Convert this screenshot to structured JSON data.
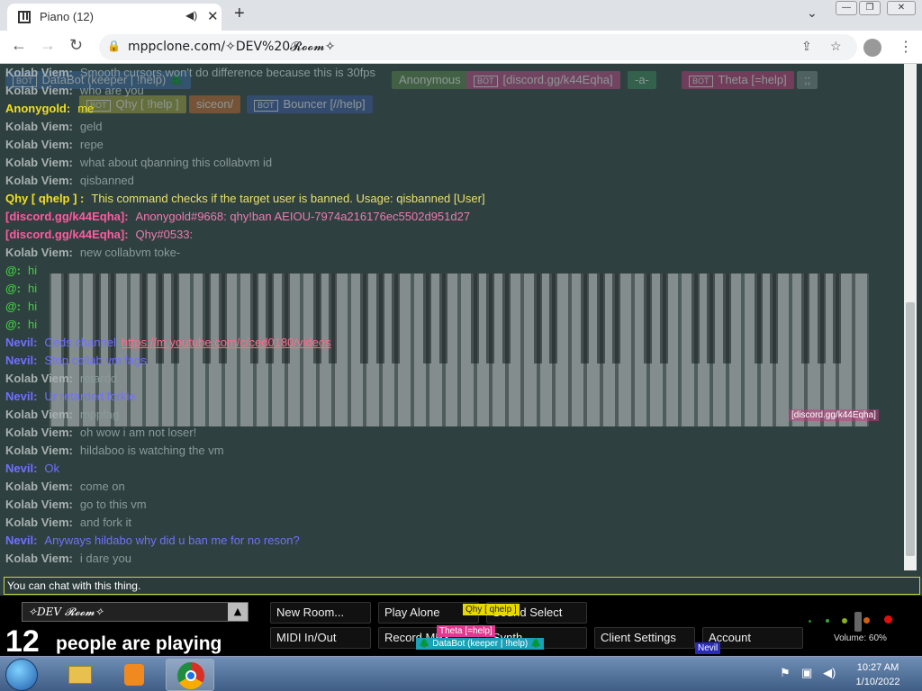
{
  "browser": {
    "tab_title": "Piano (12)",
    "url": "mppclone.com/✧DEV%20𝓡𝓸𝓸𝓶✧",
    "new_tab_label": "+"
  },
  "name_bar": [
    {
      "label": "DataBot (keeper | !help) 🌲",
      "bot": true,
      "color": "#3a6aa8"
    },
    {
      "label": "Anonymous",
      "bot": false,
      "color": "#5a8a4a"
    },
    {
      "label": "[discord.gg/k44Eqha]",
      "bot": true,
      "color": "#c24a8a"
    },
    {
      "label": "-a-",
      "bot": false,
      "color": "#3a8a5a"
    },
    {
      "label": "Theta [=help]",
      "bot": true,
      "color": "#c23a7a"
    },
    {
      "label": ";;",
      "bot": false,
      "color": "#7a8a8a"
    },
    {
      "label": "Qhy [ !help ]",
      "bot": true,
      "color": "#a8a83a"
    },
    {
      "label": "siceon/",
      "bot": false,
      "color": "#c86a2a"
    },
    {
      "label": "Bouncer [//help]",
      "bot": true,
      "color": "#3a5aa8"
    }
  ],
  "chat": [
    {
      "name": "Kolab Viem:",
      "text": "Smooth cursors won't do difference because this is 30fps",
      "name_color": "#a8b0b0",
      "text_color": "#8a9a9a"
    },
    {
      "name": "Kolab Viem:",
      "text": "who are you",
      "name_color": "#a8b0b0",
      "text_color": "#8a9a9a"
    },
    {
      "name": "Anonygold:",
      "text": "me",
      "name_color": "#f0e020",
      "text_color": "#f0e020"
    },
    {
      "name": "Kolab Viem:",
      "text": "geld",
      "name_color": "#a8b0b0",
      "text_color": "#8a9a9a"
    },
    {
      "name": "Kolab Viem:",
      "text": "repe",
      "name_color": "#a8b0b0",
      "text_color": "#8a9a9a"
    },
    {
      "name": "Kolab Viem:",
      "text": "what about qbanning this collabvm id",
      "name_color": "#a8b0b0",
      "text_color": "#8a9a9a"
    },
    {
      "name": "Kolab Viem:",
      "text": "qisbanned",
      "name_color": "#a8b0b0",
      "text_color": "#8a9a9a"
    },
    {
      "name": "Qhy [ qhelp ] :",
      "text": "This command checks if the target user is banned. Usage: qisbanned [User]",
      "name_color": "#f0e020",
      "text_color": "#e8e070"
    },
    {
      "name": "[discord.gg/k44Eqha]:",
      "text": "Anonygold#9668: qhy!ban AEIOU-7974a216176ec5502d951d27",
      "name_color": "#ff5aa0",
      "text_color": "#f07ab0"
    },
    {
      "name": "[discord.gg/k44Eqha]:",
      "text": "Qhy#0533:",
      "name_color": "#ff5aa0",
      "text_color": "#f07ab0"
    },
    {
      "name": "Kolab Viem:",
      "text": "new collabvm toke-",
      "name_color": "#a8b0b0",
      "text_color": "#8a9a9a"
    },
    {
      "name": "@:",
      "text": "hi",
      "name_color": "#40d040",
      "text_color": "#40d040"
    },
    {
      "name": "@:",
      "text": "hi",
      "name_color": "#40d040",
      "text_color": "#40d040"
    },
    {
      "name": "@:",
      "text": "hi",
      "name_color": "#40d040",
      "text_color": "#40d040"
    },
    {
      "name": "@:",
      "text": "hi",
      "name_color": "#40d040",
      "text_color": "#40d040"
    },
    {
      "name": "Nevil:",
      "text": "Ceds channel",
      "link": "https://m.youtube.com/c/ced0180/videos",
      "name_color": "#7070ff",
      "text_color": "#7070ff"
    },
    {
      "name": "Nevil:",
      "text": "Stop collab vm fags",
      "name_color": "#7070ff",
      "text_color": "#7070ff"
    },
    {
      "name": "Kolab Viem:",
      "text": "retardd",
      "name_color": "#a8b0b0",
      "text_color": "#8a9a9a"
    },
    {
      "name": "Nevil:",
      "text": "Ur retarded forkie",
      "name_color": "#7070ff",
      "text_color": "#7070ff"
    },
    {
      "name": "Kolab Viem:",
      "text": "mppfag",
      "name_color": "#a8b0b0",
      "text_color": "#8a9a9a"
    },
    {
      "name": "Kolab Viem:",
      "text": "oh wow i am not loser!",
      "name_color": "#a8b0b0",
      "text_color": "#8a9a9a"
    },
    {
      "name": "Kolab Viem:",
      "text": "hildaboo is watching the vm",
      "name_color": "#a8b0b0",
      "text_color": "#8a9a9a"
    },
    {
      "name": "Nevil:",
      "text": "Ok",
      "name_color": "#7070ff",
      "text_color": "#7070ff"
    },
    {
      "name": "Kolab Viem:",
      "text": "come on",
      "name_color": "#a8b0b0",
      "text_color": "#8a9a9a"
    },
    {
      "name": "Kolab Viem:",
      "text": "go to this vm",
      "name_color": "#a8b0b0",
      "text_color": "#8a9a9a"
    },
    {
      "name": "Kolab Viem:",
      "text": "and fork it",
      "name_color": "#a8b0b0",
      "text_color": "#8a9a9a"
    },
    {
      "name": "Nevil:",
      "text": "Anyways hildabo why did u ban me for no reson?",
      "name_color": "#7070ff",
      "text_color": "#7070ff"
    },
    {
      "name": "Kolab Viem:",
      "text": "i dare you",
      "name_color": "#a8b0b0",
      "text_color": "#8a9a9a"
    }
  ],
  "piano_cursor_label": "[discord.gg/k44Eqha]",
  "chat_input": {
    "value": "You can chat with this thing."
  },
  "bottom": {
    "room_name": "✧DEV 𝓡𝓸𝓸𝓶✧",
    "count": "12",
    "people_label": "people are playing",
    "buttons": {
      "new_room": "New Room...",
      "play_alone": "Play Alone",
      "sound_select": "Sound Select",
      "midi": "MIDI In/Out",
      "record": "Record MP3",
      "synth": "Synth",
      "client_settings": "Client Settings",
      "account": "Account"
    },
    "tags": {
      "qhy": "Qhy [ qhelp ]",
      "theta": "Theta [=help]",
      "databot": "🌲 DataBot (keeper | !help) 🌲",
      "nevil": "Nevil"
    },
    "volume": "Volume: 60%"
  },
  "taskbar": {
    "time": "10:27 AM",
    "date": "1/10/2022"
  }
}
